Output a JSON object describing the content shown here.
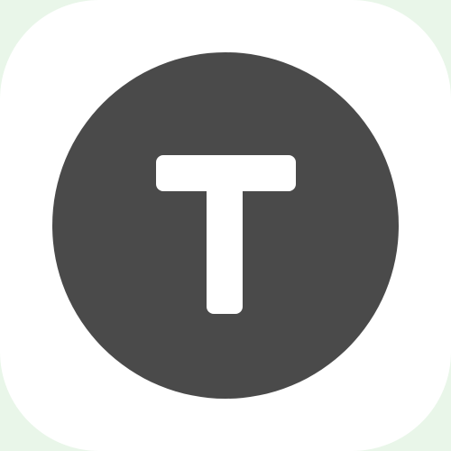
{
  "app_icon": {
    "icon": "letter-t-icon",
    "letter": "T",
    "colors": {
      "tile_background": "#ffffff",
      "badge": "#4a4a4a",
      "glyph": "#ffffff",
      "corner_tint": "#e9f6e9"
    }
  }
}
